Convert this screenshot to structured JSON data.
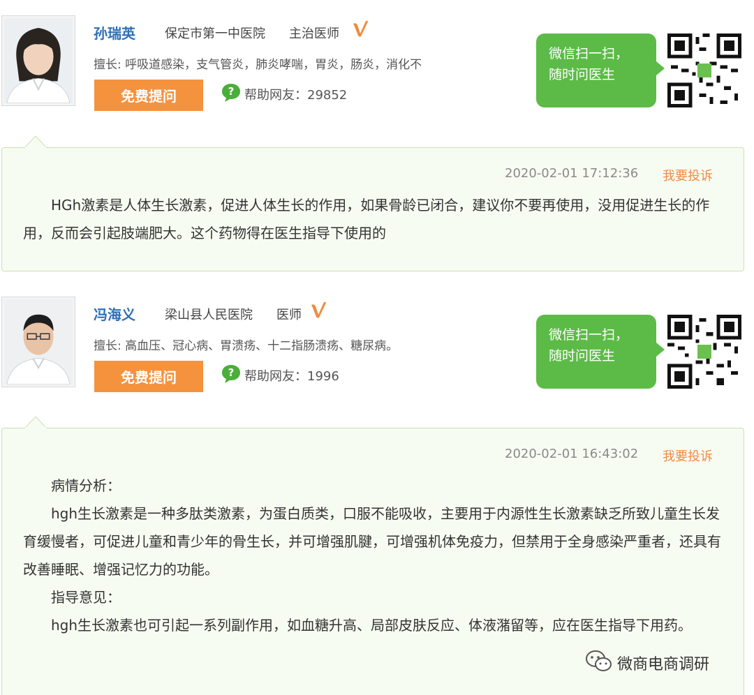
{
  "doctors": [
    {
      "name": "孙瑞英",
      "hospital": "保定市第一中医院",
      "title": "主治医师",
      "specialty": "擅长: 呼吸道感染，支气管炎，肺炎哮喘，胃炎，肠炎，消化不",
      "ask_button": "免费提问",
      "help_label": "帮助网友：",
      "help_count": "29852",
      "wechat_line1": "微信扫一扫，",
      "wechat_line2": "随时问医生",
      "reply": {
        "time": "2020-02-01 17:12:36",
        "complain": "我要投诉",
        "paragraphs": [
          "HGh激素是人体生长激素，促进人体生长的作用，如果骨龄已闭合，建议你不要再使用，没用促进生长的作用，反而会引起肢端肥大。这个药物得在医生指导下使用的"
        ]
      }
    },
    {
      "name": "冯海义",
      "hospital": "梁山县人民医院",
      "title": "医师",
      "specialty": "擅长: 高血压、冠心病、胃溃疡、十二指肠溃疡、糖尿病。",
      "ask_button": "免费提问",
      "help_label": "帮助网友：",
      "help_count": "1996",
      "wechat_line1": "微信扫一扫，",
      "wechat_line2": "随时问医生",
      "reply": {
        "time": "2020-02-01 16:43:02",
        "complain": "我要投诉",
        "paragraphs": [
          "病情分析：",
          "hgh生长激素是一种多肽类激素，为蛋白质类，口服不能吸收，主要用于内源性生长激素缺乏所致儿童生长发育缓慢者，可促进儿童和青少年的骨生长，并可增强肌腱，可增强机体免疫力，但禁用于全身感染严重者，还具有改善睡眠、增强记忆力的功能。",
          "指导意见：",
          "hgh生长激素也可引起一系列副作用，如血糖升高、局部皮肤反应、体液潴留等，应在医生指导下用药。"
        ]
      }
    }
  ],
  "footer": {
    "brand": "微商电商调研"
  },
  "colors": {
    "accent_orange": "#f5923e",
    "link_blue": "#2f6fb5",
    "wechat_green": "#5cbb47",
    "reply_bg": "#f7fcf2",
    "reply_border": "#c8e2b3"
  }
}
